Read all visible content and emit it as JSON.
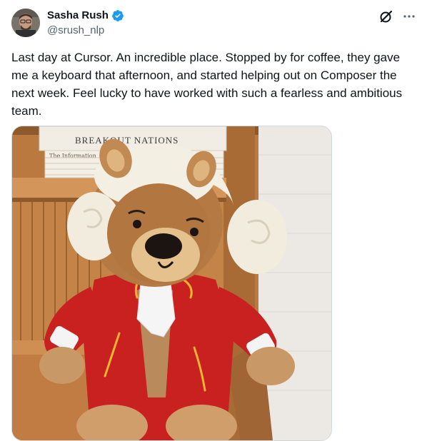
{
  "author": {
    "display_name": "Sasha Rush",
    "handle": "@srush_nlp"
  },
  "tweet": {
    "text": "Last day at Cursor. An incredible place. Stopped by for coffee, they gave me a keyboard that afternoon, and started helping out on Composer the next week. Feel lucky to have worked with such a fearless and ambitious team."
  },
  "media": {
    "book_title": "BREAKOUT NATIONS",
    "spine_text": "The Information"
  },
  "icons": {
    "verified": "verified-badge-icon",
    "grok": "grok-icon",
    "more": "more-icon"
  },
  "colors": {
    "verified_blue": "#1d9bf0",
    "text_primary": "#0f1419",
    "text_secondary": "#536471"
  }
}
